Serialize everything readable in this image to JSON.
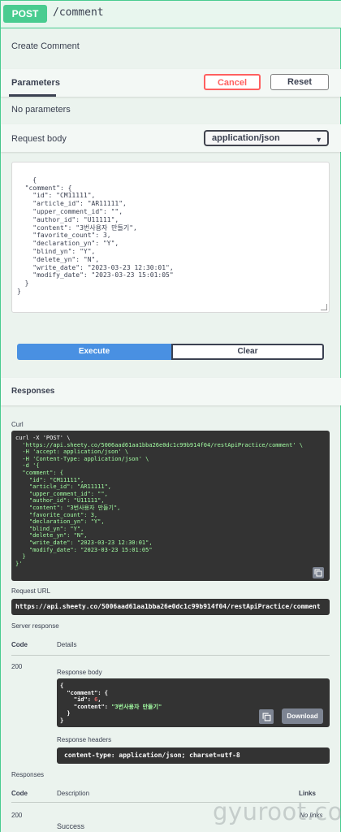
{
  "operation": {
    "method": "POST",
    "path": "/comment",
    "description": "Create Comment"
  },
  "parameters": {
    "tab_label": "Parameters",
    "cancel_label": "Cancel",
    "reset_label": "Reset",
    "empty_text": "No parameters"
  },
  "request_body": {
    "label": "Request body",
    "content_type": "application/json",
    "json": "{\n  \"comment\": {\n    \"id\": \"CM11111\",\n    \"article_id\": \"AR11111\",\n    \"upper_comment_id\": \"\",\n    \"author_id\": \"U11111\",\n    \"content\": \"3번사용자 만들기\",\n    \"favorite_count\": 3,\n    \"declaration_yn\": \"Y\",\n    \"blind_yn\": \"Y\",\n    \"delete_yn\": \"N\",\n    \"write_date\": \"2023-03-23 12:30:01\",\n    \"modify_date\": \"2023-03-23 15:01:05\"\n  }\n}"
  },
  "actions": {
    "execute_label": "Execute",
    "clear_label": "Clear"
  },
  "responses": {
    "title": "Responses",
    "curl_label": "Curl",
    "curl_cmd": "curl -X 'POST' \\",
    "curl_lines": [
      "  'https://api.sheety.co/5006aad61aa1bba26e0dc1c99b914f04/restApiPractice/comment' \\",
      "  -H 'accept: application/json' \\",
      "  -H 'Content-Type: application/json' \\",
      "  -d '{",
      "  \"comment\": {",
      "    \"id\": \"CM11111\",",
      "    \"article_id\": \"AR11111\",",
      "    \"upper_comment_id\": \"\",",
      "    \"author_id\": \"U11111\",",
      "    \"content\": \"3번사용자 만들기\",",
      "    \"favorite_count\": 3,",
      "    \"declaration_yn\": \"Y\",",
      "    \"blind_yn\": \"Y\",",
      "    \"delete_yn\": \"N\",",
      "    \"write_date\": \"2023-03-23 12:30:01\",",
      "    \"modify_date\": \"2023-03-23 15:01:05\"",
      "  }",
      "}'"
    ],
    "request_url_label": "Request URL",
    "request_url": "https://api.sheety.co/5006aad61aa1bba26e0dc1c99b914f04/restApiPractice/comment",
    "server_response_label": "Server response",
    "code_header": "Code",
    "details_header": "Details",
    "status_code": "200",
    "response_body_label": "Response body",
    "response_body": {
      "open": "{",
      "comment_open": "  \"comment\": {",
      "id_key": "    \"id\": ",
      "id_value": "6",
      "id_comma": ",",
      "content_key": "    \"content\": ",
      "content_value": "\"3번사용자 만들기\"",
      "comment_close": "  }",
      "close": "}"
    },
    "download_label": "Download",
    "response_headers_label": "Response headers",
    "response_headers": "content-type: application/json; charset=utf-8",
    "doc_responses_label": "Responses",
    "doc_code_header": "Code",
    "doc_description_header": "Description",
    "doc_links_header": "Links",
    "doc_code": "200",
    "doc_description": "Success",
    "doc_links": "No links"
  },
  "watermark": "gyuroot.com",
  "colors": {
    "post_green": "#49cc90",
    "execute_blue": "#4990e2",
    "cancel_red": "#ff6060",
    "code_bg": "#333333"
  }
}
